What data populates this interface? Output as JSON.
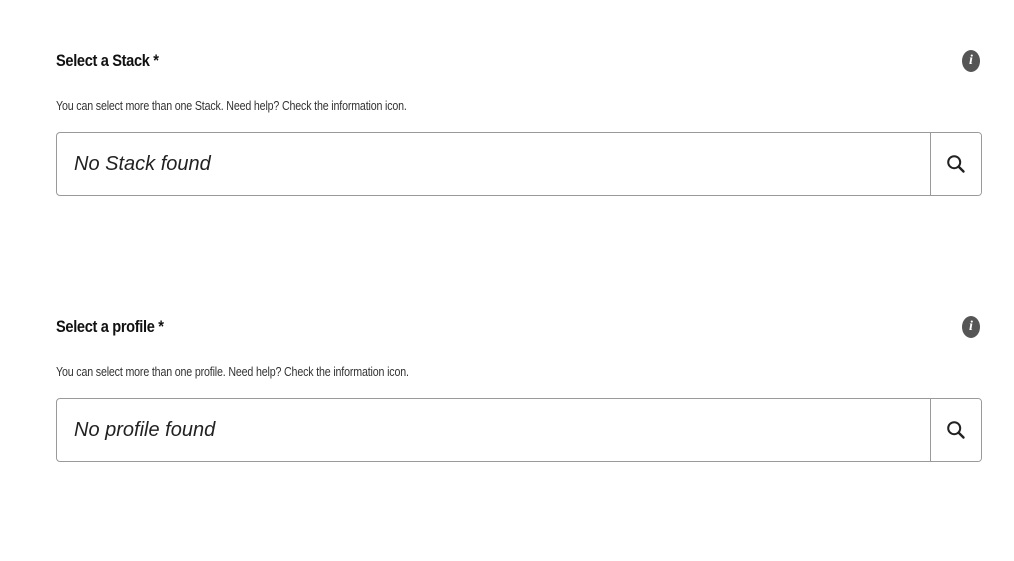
{
  "stack": {
    "title": "Select a Stack *",
    "hint": "You can select more than one Stack. Need help? Check the information icon.",
    "search_placeholder": "No Stack found",
    "info_icon": "info-icon",
    "search_icon": "search-icon"
  },
  "profile": {
    "title": "Select a profile *",
    "hint": "You can select more than one profile. Need help? Check the information icon.",
    "search_placeholder": "No profile found",
    "info_icon": "info-icon",
    "search_icon": "search-icon"
  },
  "colors": {
    "icon_fill": "#555555",
    "border": "#9a9a9a",
    "text": "#222222"
  }
}
